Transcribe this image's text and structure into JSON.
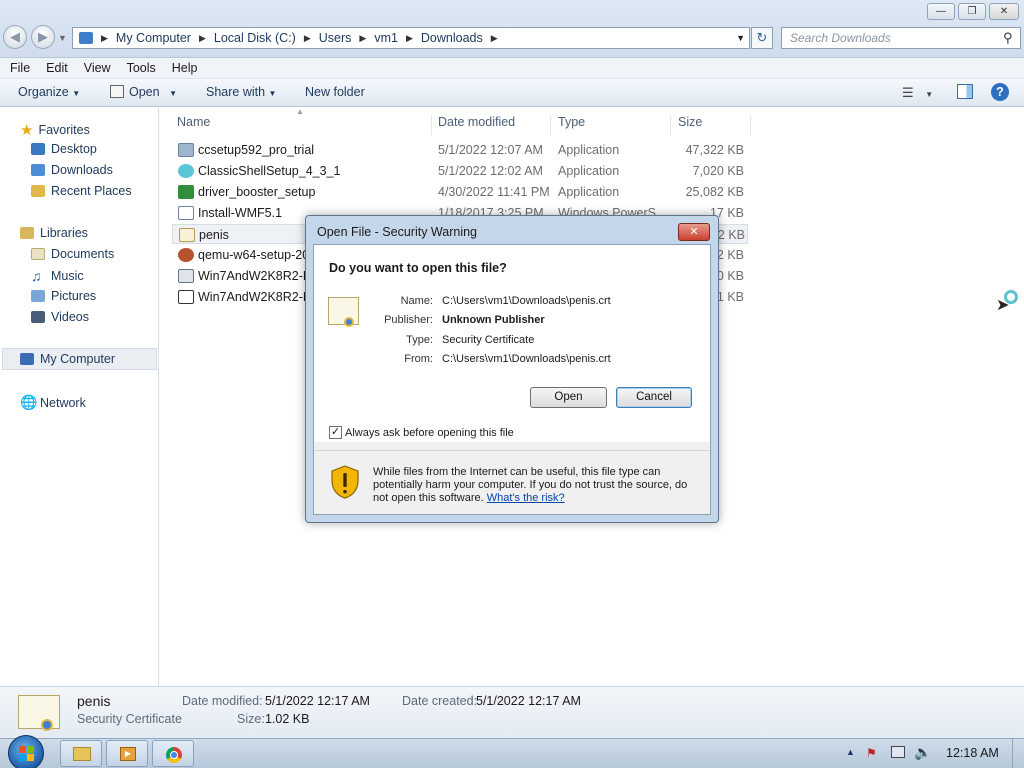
{
  "address": {
    "crumbs": [
      "My Computer",
      "Local Disk (C:)",
      "Users",
      "vm1",
      "Downloads"
    ],
    "search_placeholder": "Search Downloads"
  },
  "menubar": [
    "File",
    "Edit",
    "View",
    "Tools",
    "Help"
  ],
  "toolbar": {
    "organize": "Organize",
    "open": "Open",
    "share": "Share with",
    "new_folder": "New folder"
  },
  "nav": {
    "favorites": "Favorites",
    "favorites_items": [
      "Desktop",
      "Downloads",
      "Recent Places"
    ],
    "libraries": "Libraries",
    "libraries_items": [
      "Documents",
      "Music",
      "Pictures",
      "Videos"
    ],
    "computer": "My Computer",
    "network": "Network"
  },
  "columns": {
    "name": "Name",
    "date": "Date modified",
    "type": "Type",
    "size": "Size"
  },
  "files": [
    {
      "name": "ccsetup592_pro_trial",
      "date": "5/1/2022 12:07 AM",
      "type": "Application",
      "size": "47,322 KB"
    },
    {
      "name": "ClassicShellSetup_4_3_1",
      "date": "5/1/2022 12:02 AM",
      "type": "Application",
      "size": "7,020 KB"
    },
    {
      "name": "driver_booster_setup",
      "date": "4/30/2022 11:41 PM",
      "type": "Application",
      "size": "25,082 KB"
    },
    {
      "name": "Install-WMF5.1",
      "date": "1/18/2017 3:25 PM",
      "type": "Windows PowerS",
      "size": "17 KB"
    },
    {
      "name": "penis",
      "date": "",
      "type": "",
      "size": "2 KB"
    },
    {
      "name": "qemu-w64-setup-20",
      "date": "",
      "type": "",
      "size": "22 KB"
    },
    {
      "name": "Win7AndW2K8R2-KE",
      "date": "",
      "type": "",
      "size": "60 KB"
    },
    {
      "name": "Win7AndW2K8R2-KE",
      "date": "",
      "type": "",
      "size": "31 KB"
    }
  ],
  "details": {
    "name": "penis",
    "type": "Security Certificate",
    "date_modified_label": "Date modified:",
    "date_modified": "5/1/2022 12:17 AM",
    "size_label": "Size:",
    "size": "1.02 KB",
    "date_created_label": "Date created:",
    "date_created": "5/1/2022 12:17 AM"
  },
  "dialog": {
    "title": "Open File - Security Warning",
    "question": "Do you want to open this file?",
    "fields": {
      "name_label": "Name:",
      "name": "C:\\Users\\vm1\\Downloads\\penis.crt",
      "publisher_label": "Publisher:",
      "publisher": "Unknown Publisher",
      "type_label": "Type:",
      "type": "Security Certificate",
      "from_label": "From:",
      "from": "C:\\Users\\vm1\\Downloads\\penis.crt"
    },
    "open_button": "Open",
    "cancel_button": "Cancel",
    "checkbox_label": "Always ask before opening this file",
    "checkbox_checked": true,
    "warning_text": "While files from the Internet can be useful, this file type can potentially harm your computer. If you do not trust the source, do not open this software.",
    "risk_link": "What's the risk?"
  },
  "taskbar": {
    "clock": "12:18 AM"
  }
}
